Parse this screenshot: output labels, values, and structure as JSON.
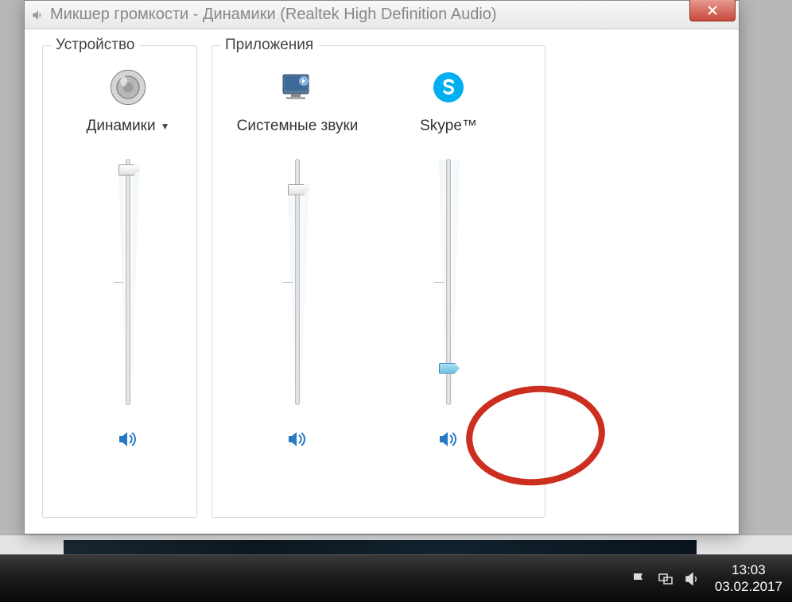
{
  "window": {
    "title": "Микшер громкости - Динамики (Realtek High Definition Audio)"
  },
  "groups": {
    "device_label": "Устройство",
    "apps_label": "Приложения"
  },
  "channels": {
    "speakers": {
      "label": "Динамики",
      "volume": 98,
      "muted": false
    },
    "system": {
      "label": "Системные звуки",
      "volume": 90,
      "muted": false
    },
    "skype": {
      "label": "Skype™",
      "volume": 17,
      "muted": false
    }
  },
  "taskbar": {
    "time": "13:03",
    "date": "03.02.2017"
  },
  "colors": {
    "annotation": "#cc2e1f",
    "icon_blue": "#2878c4",
    "skype_blue": "#00aff0"
  }
}
